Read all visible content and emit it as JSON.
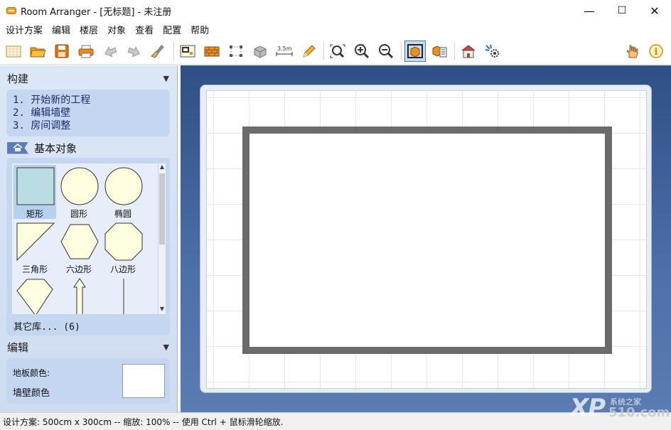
{
  "window": {
    "title": "Room Arranger - [无标题] - 未注册",
    "minimize": "—",
    "maximize": "☐",
    "close": "✕"
  },
  "menu": [
    "设计方案",
    "编辑",
    "楼层",
    "对象",
    "查看",
    "配置",
    "帮助"
  ],
  "toolbar": {
    "icons": [
      "new-plan-icon",
      "open-icon",
      "save-icon",
      "print-icon",
      "undo-icon",
      "redo-icon",
      "clean-icon",
      "wall-editor-icon",
      "brick-wall-icon",
      "select-points-icon",
      "3d-box-icon",
      "measure-icon",
      "pencil-icon",
      "zoom-fit-icon",
      "zoom-in-icon",
      "zoom-out-icon",
      "3d-view-icon",
      "objects-list-icon",
      "house-icon",
      "settings-icon",
      "hand-icon",
      "info-icon"
    ],
    "measure_text": "3.5m",
    "active": "3d-view-icon"
  },
  "left_panel": {
    "build": {
      "title": "构建",
      "steps": [
        {
          "num": "1.",
          "text": "开始新的工程"
        },
        {
          "num": "2.",
          "text": "编辑墙壁"
        },
        {
          "num": "3.",
          "text": "房间调整"
        }
      ]
    },
    "basic_objects": {
      "title": "基本对象",
      "shapes": [
        "矩形",
        "圆形",
        "椭圆",
        "三角形",
        "六边形",
        "八边形"
      ],
      "selected": "矩形",
      "more": "其它库... (6)"
    },
    "edit": {
      "title": "编辑",
      "floor_color_label": "地板颜色:",
      "wall_color_label": "墙壁颜色",
      "floor_color": "#ffffff"
    }
  },
  "colors": {
    "canvas_bg_top": "#2f4f86",
    "wall": "#6b6b6b",
    "panel_bg": "#dce7f7",
    "shape_fill": "#fffde0",
    "selected_shape_fill": "#b9dde3"
  },
  "status": {
    "text": "设计方案: 500cm x 300cm -- 缩放: 100% -- 使用 Ctrl + 鼠标滑轮缩放."
  },
  "watermark": {
    "big": "XP",
    "small": "系统之家",
    "num": "510.com"
  }
}
